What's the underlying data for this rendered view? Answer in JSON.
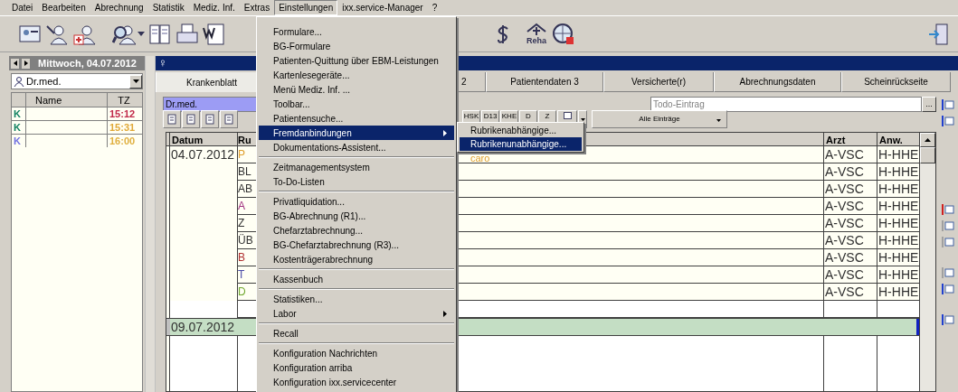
{
  "menubar": [
    {
      "label": "Datei",
      "selected": false
    },
    {
      "label": "Bearbeiten",
      "selected": false
    },
    {
      "label": "Abrechnung",
      "selected": false
    },
    {
      "label": "Statistik",
      "selected": false
    },
    {
      "label": "Mediz. Inf.",
      "selected": false
    },
    {
      "label": "Extras",
      "selected": false
    },
    {
      "label": "Einstellungen",
      "selected": true
    },
    {
      "label": "ixx.service-Manager",
      "selected": false
    },
    {
      "label": "?",
      "selected": false
    }
  ],
  "toolbar": {
    "reha_label": "Reha"
  },
  "left_panel": {
    "date": "Mittwoch, 04.07.2012",
    "doctor": "Dr.med.",
    "columns": [
      "Name",
      "TZ"
    ],
    "rows": [
      {
        "letter": {
          "text": "K",
          "color": "#108060"
        },
        "time": {
          "text": "15:12",
          "color": "#c02848"
        }
      },
      {
        "letter": {
          "text": "K",
          "color": "#108060"
        },
        "time": {
          "text": "15:31",
          "color": "#e0a838"
        }
      },
      {
        "letter": {
          "text": "K",
          "color": "#7070e0"
        },
        "time": {
          "text": "16:00",
          "color": "#e0b040"
        }
      }
    ]
  },
  "patient": {
    "symbol": "♀",
    "tabs": [
      {
        "label": "Krankenblatt",
        "selected": true
      },
      {
        "label": "2",
        "selected": false
      },
      {
        "label": "Patientendaten 3",
        "selected": false
      },
      {
        "label": "Versicherte(r)",
        "selected": false
      },
      {
        "label": "Abrechnungsdaten",
        "selected": false
      },
      {
        "label": "Scheinrückseite",
        "selected": false
      }
    ],
    "doctor_field": "Dr.med.",
    "todo": {
      "placeholder": "Todo-Eintrag"
    },
    "todo_button": "...",
    "filters": [
      "HSK",
      "D13",
      "KHE",
      "D",
      "Z"
    ],
    "entries_filter": "Alle Einträge",
    "table": {
      "columns": [
        "Datum",
        "Ru",
        "Arzt",
        "Anw."
      ],
      "rows": [
        {
          "kind": "entry",
          "date": "04.07.2012",
          "rubric": "P",
          "color": "#e0a030",
          "text": "caro",
          "doctor": "A-VSC",
          "user": "H-HHE"
        },
        {
          "kind": "entry",
          "rubric": "BL",
          "color": "#303030",
          "doctor": "A-VSC",
          "user": "H-HHE"
        },
        {
          "kind": "entry",
          "rubric": "AB",
          "color": "#303030",
          "doctor": "A-VSC",
          "user": "H-HHE"
        },
        {
          "kind": "entry",
          "rubric": "A",
          "color": "#a03080",
          "doctor": "A-VSC",
          "user": "H-HHE"
        },
        {
          "kind": "entry",
          "rubric": "Z",
          "color": "#303030",
          "doctor": "A-VSC",
          "user": "H-HHE"
        },
        {
          "kind": "entry",
          "rubric": "ÜB",
          "color": "#303030",
          "doctor": "A-VSC",
          "user": "H-HHE"
        },
        {
          "kind": "entry",
          "rubric": "B",
          "color": "#b03030",
          "doctor": "A-VSC",
          "user": "H-HHE"
        },
        {
          "kind": "entry",
          "rubric": "T",
          "color": "#4848a8",
          "doctor": "A-VSC",
          "user": "H-HHE"
        },
        {
          "kind": "entry",
          "rubric": "D",
          "color": "#70a830",
          "doctor": "A-VSC",
          "user": "H-HHE"
        },
        {
          "kind": "blank"
        },
        {
          "kind": "day",
          "date": "09.07.2012"
        },
        {
          "kind": "blank"
        }
      ]
    }
  },
  "menu": [
    {
      "kind": "item",
      "label": "Formulare...",
      "selected": false
    },
    {
      "kind": "item",
      "label": "BG-Formulare",
      "selected": false
    },
    {
      "kind": "item",
      "label": "Patienten-Quittung über EBM-Leistungen",
      "selected": false
    },
    {
      "kind": "item",
      "label": "Kartenlesegeräte...",
      "selected": false
    },
    {
      "kind": "item",
      "label": "Menü Mediz. Inf. ...",
      "selected": false
    },
    {
      "kind": "item",
      "label": "Toolbar...",
      "selected": false
    },
    {
      "kind": "item",
      "label": "Patientensuche...",
      "selected": false
    },
    {
      "kind": "submenu",
      "label": "Fremdanbindungen",
      "selected": true
    },
    {
      "kind": "item",
      "label": "Dokumentations-Assistent...",
      "selected": false
    },
    {
      "kind": "separator"
    },
    {
      "kind": "item",
      "label": "Zeitmanagementsystem",
      "selected": false
    },
    {
      "kind": "item",
      "label": "To-Do-Listen",
      "selected": false
    },
    {
      "kind": "separator"
    },
    {
      "kind": "item",
      "label": "Privatliquidation...",
      "selected": false
    },
    {
      "kind": "item",
      "label": "BG-Abrechnung (R1)...",
      "selected": false
    },
    {
      "kind": "item",
      "label": "Chefarztabrechnung...",
      "selected": false
    },
    {
      "kind": "item",
      "label": "BG-Chefarztabrechnung (R3)...",
      "selected": false
    },
    {
      "kind": "item",
      "label": "Kostenträgerabrechnung",
      "selected": false
    },
    {
      "kind": "separator"
    },
    {
      "kind": "item",
      "label": "Kassenbuch",
      "selected": false
    },
    {
      "kind": "separator"
    },
    {
      "kind": "item",
      "label": "Statistiken...",
      "selected": false
    },
    {
      "kind": "submenu",
      "label": "Labor",
      "selected": false
    },
    {
      "kind": "separator"
    },
    {
      "kind": "item",
      "label": "Recall",
      "selected": false
    },
    {
      "kind": "separator"
    },
    {
      "kind": "item",
      "label": "Konfiguration Nachrichten",
      "selected": false
    },
    {
      "kind": "item",
      "label": "Konfiguration arriba",
      "selected": false
    },
    {
      "kind": "item",
      "label": "Konfiguration ixx.servicecenter",
      "selected": false
    }
  ],
  "submenu": [
    {
      "label": "Rubrikenabhängige...",
      "selected": false
    },
    {
      "label": "Rubrikenunabhängige...",
      "selected": true
    }
  ]
}
